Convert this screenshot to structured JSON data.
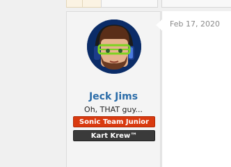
{
  "user": {
    "name": "Jeck Jims",
    "title": "Oh, THAT guy...",
    "avatar_icon": "user-avatar-icon",
    "banners": [
      {
        "label": "Sonic Team Junior",
        "color": "#d93a0f"
      },
      {
        "label": "Kart Krew™",
        "color": "#3a3a3a"
      }
    ]
  },
  "post": {
    "date": "Feb 17, 2020"
  },
  "colors": {
    "username": "#2b6ca8",
    "panel_bg": "#f4f4f4"
  }
}
